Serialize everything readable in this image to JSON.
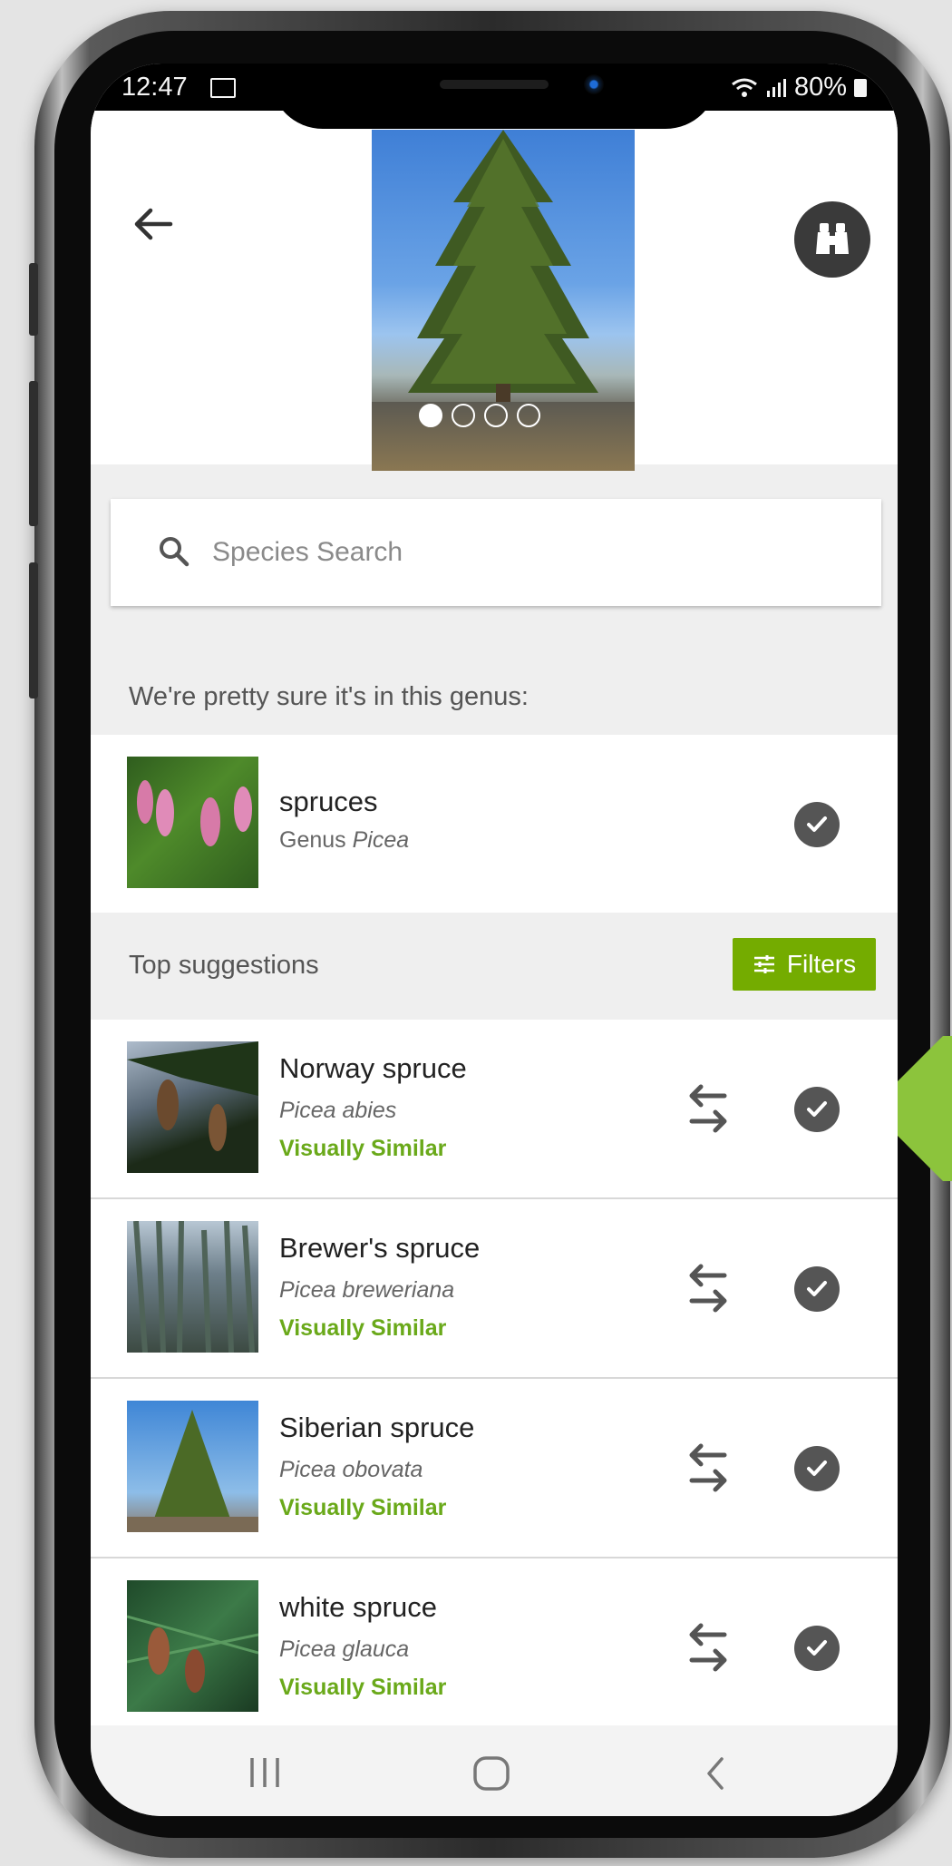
{
  "status_bar": {
    "time": "12:47",
    "battery": "80%"
  },
  "header": {
    "photo_count": 4,
    "active_photo": 1
  },
  "search": {
    "placeholder": "Species Search"
  },
  "genus_section": {
    "heading": "We're pretty sure it's in this genus:",
    "name": "spruces",
    "rank": "Genus",
    "scientific": "Picea"
  },
  "suggestions_section": {
    "heading": "Top suggestions",
    "filters_label": "Filters",
    "items": [
      {
        "name": "Norway spruce",
        "scientific": "Picea abies",
        "tag": "Visually Similar"
      },
      {
        "name": "Brewer's spruce",
        "scientific": "Picea breweriana",
        "tag": "Visually Similar"
      },
      {
        "name": "Siberian spruce",
        "scientific": "Picea obovata",
        "tag": "Visually Similar"
      },
      {
        "name": "white spruce",
        "scientific": "Picea glauca",
        "tag": "Visually Similar"
      }
    ]
  },
  "colors": {
    "accent_green": "#74ac00",
    "tag_green": "#6aa91a",
    "callout_green": "#8cc43c",
    "check_gray": "#555555"
  },
  "icons": [
    "back-arrow-icon",
    "binoculars-icon",
    "search-icon",
    "check-icon",
    "compare-arrows-icon",
    "filters-icon",
    "recents-icon",
    "home-icon",
    "back-icon"
  ]
}
